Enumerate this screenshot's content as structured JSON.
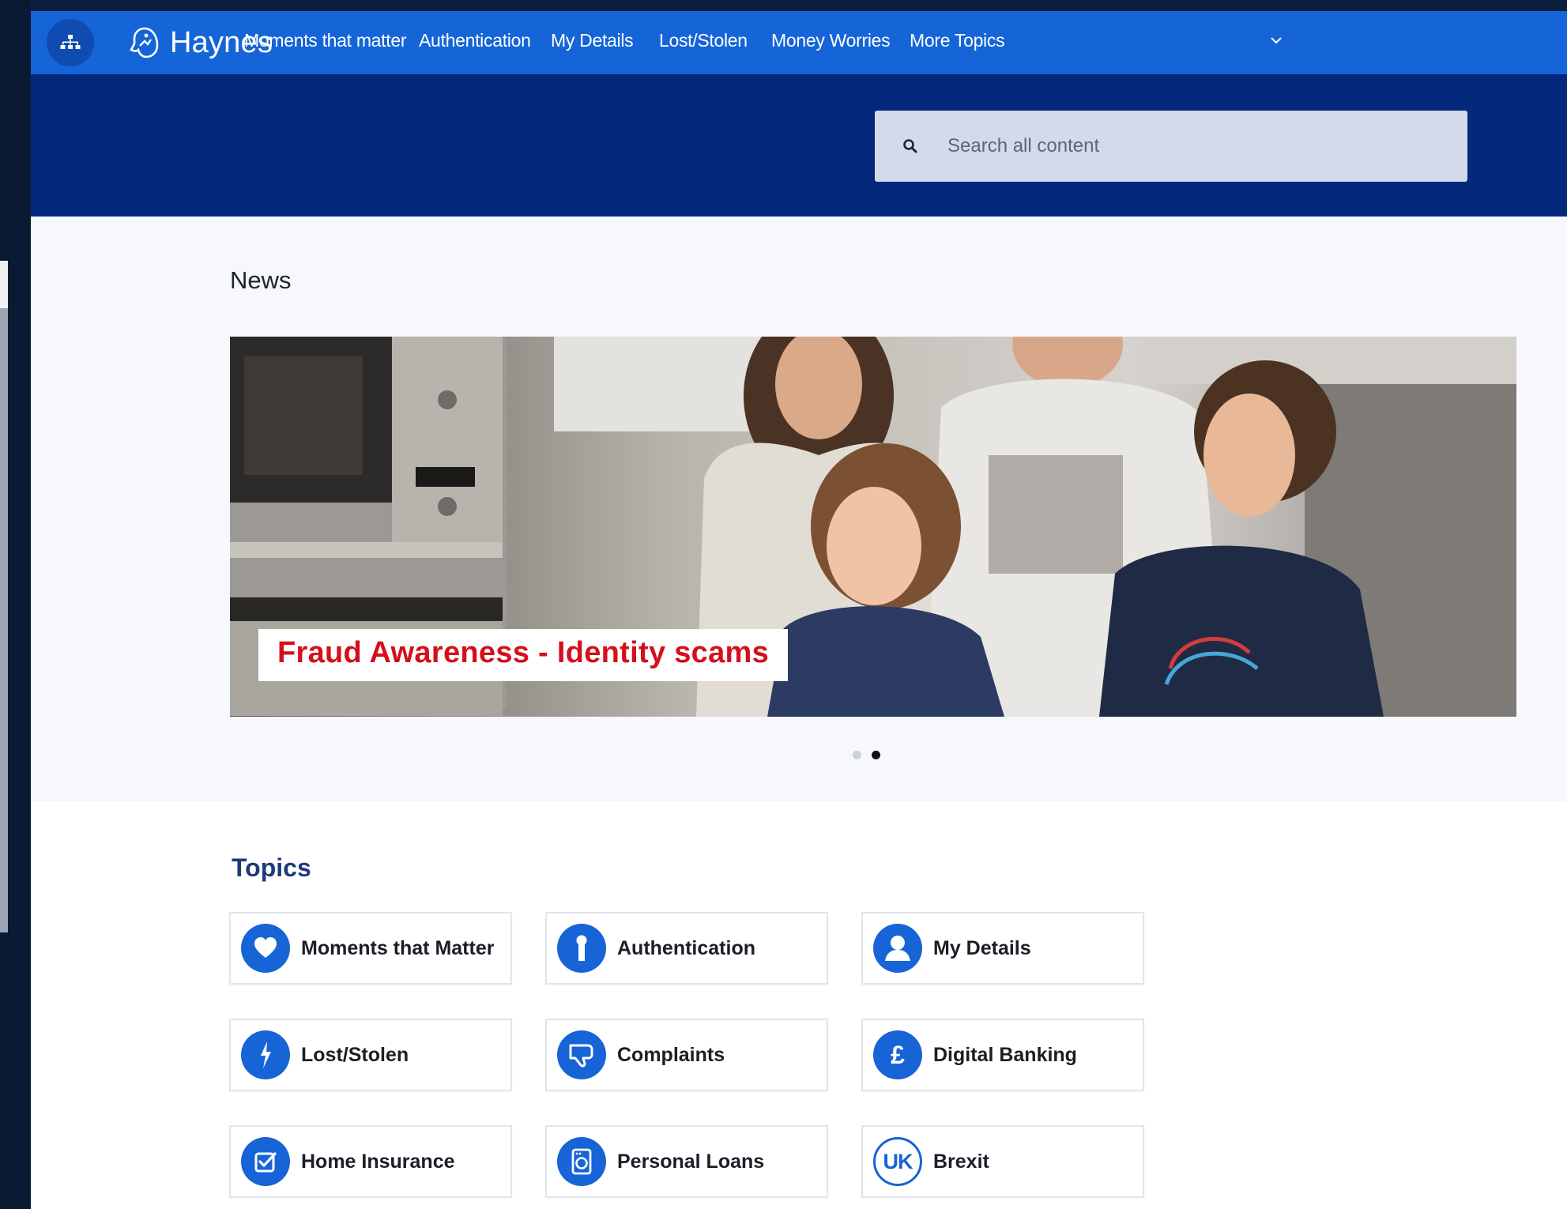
{
  "brand": {
    "name": "Haynes",
    "accent": "#1565d8",
    "hero_bg": "#04287c"
  },
  "nav": {
    "items": [
      {
        "label": "Moments that matter"
      },
      {
        "label": "Authentication"
      },
      {
        "label": "My Details"
      },
      {
        "label": "Lost/Stolen"
      },
      {
        "label": "Money Worries"
      },
      {
        "label": "More Topics"
      }
    ]
  },
  "search": {
    "placeholder": "Search all content",
    "value": ""
  },
  "news": {
    "title": "News",
    "slide_caption": "Fraud Awareness - Identity scams",
    "caption_color": "#d3101b",
    "slide_count": 2,
    "active_slide": 2
  },
  "topics": {
    "title": "Topics",
    "items": [
      {
        "label": "Moments that Matter",
        "icon": "heart-icon"
      },
      {
        "label": "Authentication",
        "icon": "keyhole-icon"
      },
      {
        "label": "My Details",
        "icon": "person-icon"
      },
      {
        "label": "Lost/Stolen",
        "icon": "lightning-icon"
      },
      {
        "label": "Complaints",
        "icon": "thumbs-down-icon"
      },
      {
        "label": "Digital Banking",
        "icon": "pound-icon"
      },
      {
        "label": "Home Insurance",
        "icon": "checkbox-icon"
      },
      {
        "label": "Personal Loans",
        "icon": "washing-machine-icon"
      },
      {
        "label": "Brexit",
        "icon": "uk-badge-icon",
        "badge_text": "UK"
      }
    ]
  }
}
